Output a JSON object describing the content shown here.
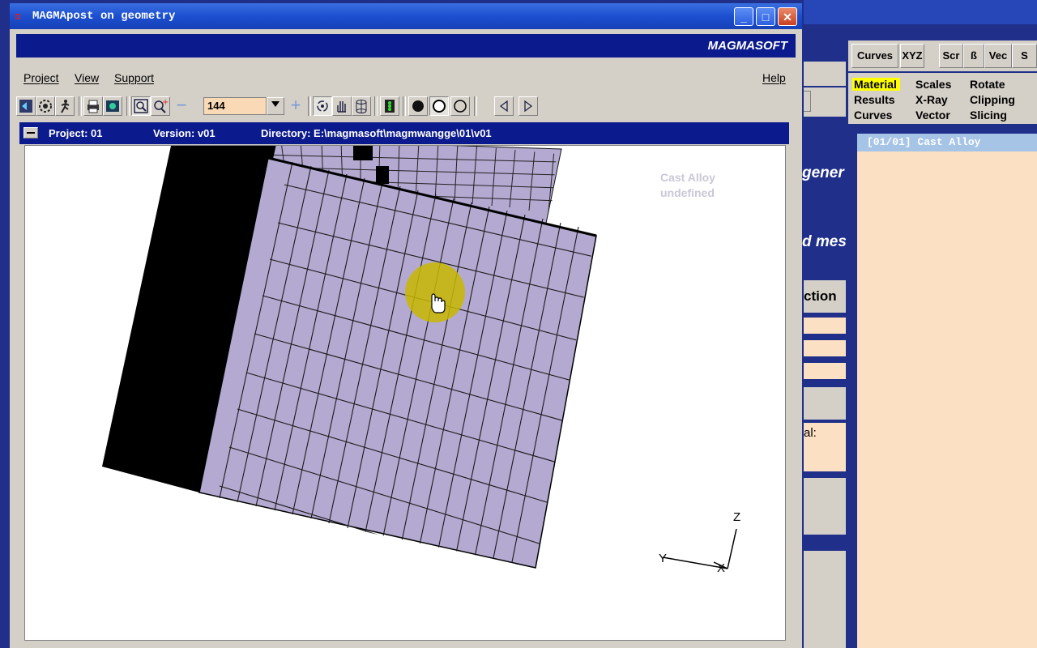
{
  "window": {
    "title": "MAGMApost on geometry",
    "logo_glyph": "₪",
    "minimize": "_",
    "maximize": "□",
    "close": "✕"
  },
  "brand": "MAGMASOFT",
  "menu": {
    "project": "Project",
    "view": "View",
    "support": "Support",
    "help": "Help"
  },
  "toolbar": {
    "zoom_value": "144"
  },
  "project_bar": {
    "project": "Project: 01",
    "version": "Version: v01",
    "directory": "Directory: E:\\magmasoft\\magmwangge\\01\\v01"
  },
  "viewport": {
    "material_line1": "Cast Alloy",
    "material_line2": "undefined",
    "axis_z": "Z",
    "axis_y": "Y",
    "axis_x": "X"
  },
  "right_panel": {
    "tabs": [
      "Curves",
      "XYZ",
      "Scr",
      "ß",
      "Vec",
      "S"
    ],
    "options": {
      "material": "Material",
      "scales": "Scales",
      "rotate": "Rotate",
      "results": "Results",
      "xray": "X-Ray",
      "clipping": "Clipping",
      "curves": "Curves",
      "vector": "Vector",
      "slicing": "Slicing"
    },
    "list_item": "[01/01]  Cast Alloy"
  },
  "background_window": {
    "text1": "gener",
    "text2": "d mes",
    "text3": "ction",
    "text4": "al:"
  }
}
